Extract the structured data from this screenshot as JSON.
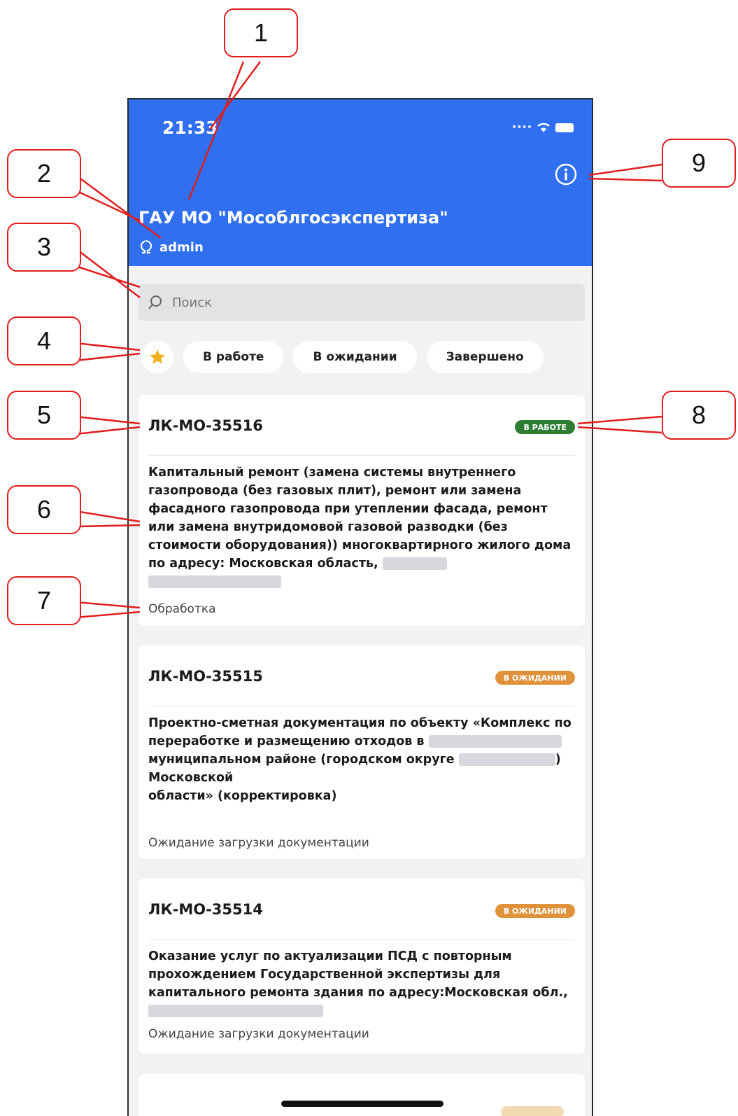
{
  "status_bar": {
    "time": "21:33"
  },
  "header": {
    "org_title": "ГАУ МО \"Мособлгосэкспертиза\"",
    "user_name": "admin"
  },
  "search": {
    "placeholder": "Поиск"
  },
  "filters": {
    "items": [
      {
        "label": "В работе"
      },
      {
        "label": "В ожидании"
      },
      {
        "label": "Завершено"
      }
    ]
  },
  "cards": [
    {
      "number": "ЛК-МО-35516",
      "badge": "В РАБОТЕ",
      "badge_color": "#2e7d32",
      "description": "Капитальный ремонт (замена системы внутреннего газопровода (без газовых плит), ремонт или замена фасадного газопровода при утеплении фасада, ремонт или замена внутридомовой газовой разводки (без стоимости оборудования)) многоквартирного жилого дома по адресу: Московская область,",
      "state": "Обработка"
    },
    {
      "number": "ЛК-МО-35515",
      "badge": "В ОЖИДАНИИ",
      "badge_color": "#e0923a",
      "description_1": "Проектно-сметная документация по объекту «Комплекс по переработке и размещению отходов в",
      "description_2": "муниципальном районе (городском округе",
      "description_3": ") Московской",
      "description_4": "области» (корректировка)",
      "state": "Ожидание загрузки документации"
    },
    {
      "number": "ЛК-МО-35514",
      "badge": "В ОЖИДАНИИ",
      "badge_color": "#e0923a",
      "description": "Оказание услуг по актуализации ПСД с повторным прохождением Государственной экспертизы для капитального ремонта здания по адресу:Московская обл.,",
      "state": "Ожидание загрузки документации"
    }
  ],
  "callouts": [
    "1",
    "2",
    "3",
    "4",
    "5",
    "6",
    "7",
    "8",
    "9"
  ],
  "colors": {
    "header_bg": "#2f6ff0",
    "callout_border": "#e01e1e",
    "star": "#f2b01e"
  }
}
